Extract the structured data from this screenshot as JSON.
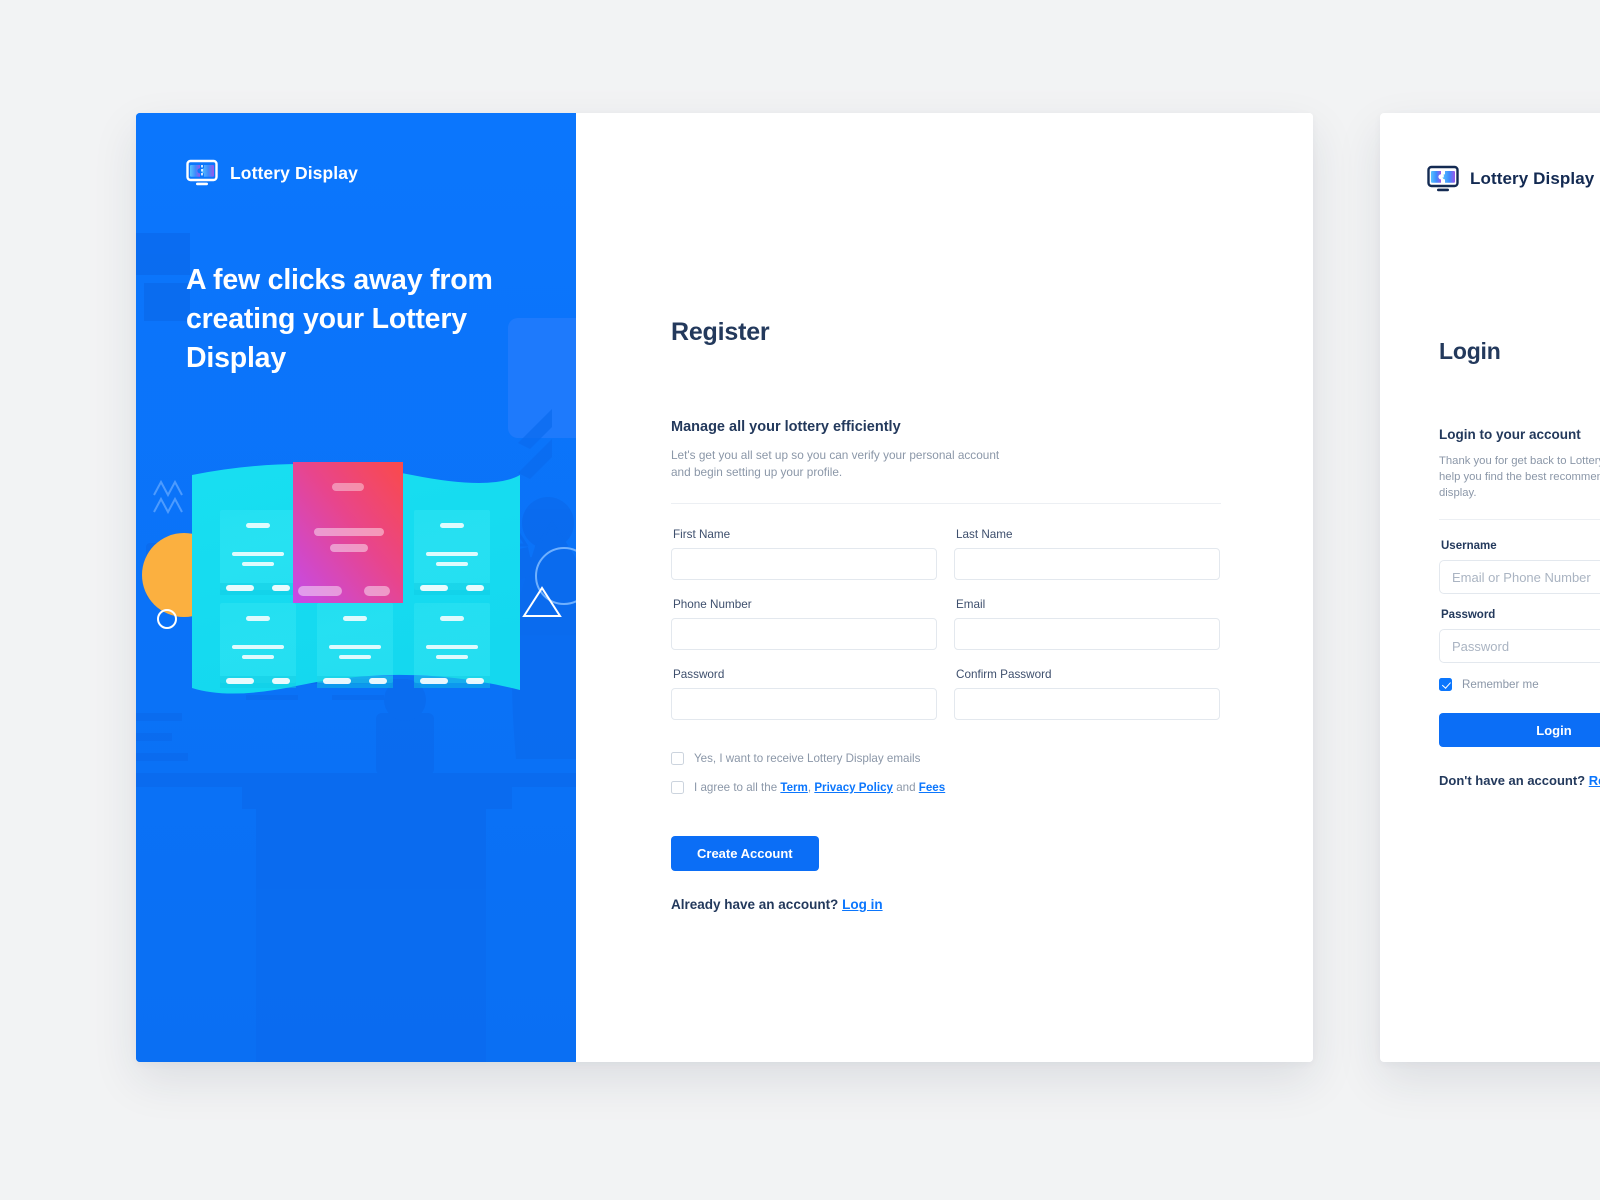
{
  "brand": {
    "name": "Lottery Display",
    "logo_icon": "lottery-ticket-monitor-icon",
    "blue": "#0b76fd",
    "navy": "#23395c"
  },
  "promo": {
    "headline": "A few clicks away from creating your Lottery Display",
    "illustration_name": "lottery-kiosk-illustration"
  },
  "register": {
    "title": "Register",
    "subtitle": "Manage all your lottery efficiently",
    "description": "Let's get you all set up so you can verify your personal account and begin setting up your profile.",
    "fields": [
      {
        "label": "First Name",
        "value": "",
        "placeholder": "",
        "type": "text",
        "name": "first-name"
      },
      {
        "label": "Last Name",
        "value": "",
        "placeholder": "",
        "type": "text",
        "name": "last-name"
      },
      {
        "label": "Phone Number",
        "value": "",
        "placeholder": "",
        "type": "text",
        "name": "phone-number"
      },
      {
        "label": "Email",
        "value": "",
        "placeholder": "",
        "type": "text",
        "name": "email"
      },
      {
        "label": "Password",
        "value": "",
        "placeholder": "",
        "type": "password",
        "name": "password"
      },
      {
        "label": "Confirm Password",
        "value": "",
        "placeholder": "",
        "type": "password",
        "name": "confirm-password"
      }
    ],
    "checkbox_emails": {
      "label": "Yes, I want to receive Lottery Display emails",
      "checked": false
    },
    "checkbox_terms": {
      "prefix": "I agree to all the ",
      "link_term": "Term",
      "separator1": ", ",
      "link_privacy": "Privacy Policy",
      "separator2": " and ",
      "link_fees": "Fees",
      "checked": false
    },
    "submit_label": "Create Account",
    "footer_text": "Already have an account?",
    "footer_link": "Log in"
  },
  "login": {
    "title": "Login",
    "subtitle": "Login to your account",
    "description": "Thank you for get back to Lottery Display, let us help you find the best recommendation for your display.",
    "username_label": "Username",
    "username_placeholder": "Email or Phone Number",
    "username_value": "",
    "password_label": "Password",
    "password_placeholder": "Password",
    "password_value": "",
    "remember_label": "Remember me",
    "remember_checked": true,
    "submit_label": "Login",
    "footer_text": "Don't have an account?",
    "footer_link": "Register"
  }
}
